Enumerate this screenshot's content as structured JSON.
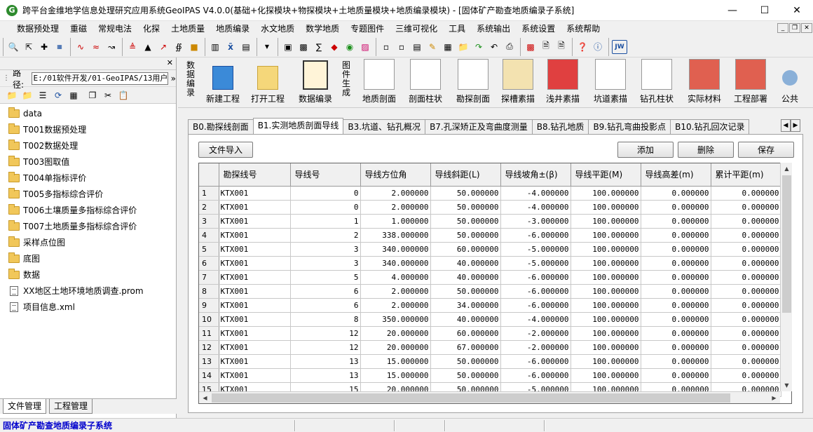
{
  "window": {
    "title": "跨平台金维地学信息处理研究应用系统GeoIPAS V4.0.0(基础+化探模块+物探模块+土地质量模块+地质编录模块) - [固体矿产勘查地质编录子系统]",
    "app_icon_letter": "G"
  },
  "menubar": [
    "数据预处理",
    "重磁",
    "常规电法",
    "化探",
    "土地质量",
    "地质编录",
    "水文地质",
    "数学地质",
    "专题图件",
    "三维可视化",
    "工具",
    "系统输出",
    "系统设置",
    "系统帮助"
  ],
  "left_panel": {
    "path_label": "路径:",
    "path_value": "E:/01软件开发/01-GeoIPAS/13用户",
    "tree": [
      {
        "type": "folder",
        "label": "data"
      },
      {
        "type": "folder",
        "label": "T001数据预处理"
      },
      {
        "type": "folder",
        "label": "T002数据处理"
      },
      {
        "type": "folder",
        "label": "T003图取值"
      },
      {
        "type": "folder",
        "label": "T004单指标评价"
      },
      {
        "type": "folder",
        "label": "T005多指标综合评价"
      },
      {
        "type": "folder",
        "label": "T006土壤质量多指标综合评价"
      },
      {
        "type": "folder",
        "label": "T007土地质量多指标综合评价"
      },
      {
        "type": "folder",
        "label": "采样点位图"
      },
      {
        "type": "folder",
        "label": "底图"
      },
      {
        "type": "folder",
        "label": "数据"
      },
      {
        "type": "file",
        "label": "XX地区土地环境地质调查.prom"
      },
      {
        "type": "file",
        "label": "项目信息.xml"
      }
    ],
    "tabs": [
      "文件管理",
      "工程管理"
    ]
  },
  "ribbon": {
    "group1_label": "数据编录",
    "group2_label": "图件生成",
    "buttons1": [
      "新建工程",
      "打开工程",
      "数据编录"
    ],
    "buttons2": [
      "地质剖面",
      "剖面柱状",
      "勘探剖面",
      "探槽素描",
      "浅井素描",
      "坑道素描",
      "钻孔柱状",
      "实际材料",
      "工程部署"
    ],
    "public_label": "公共"
  },
  "tabs": [
    "B0.勘探线剖面",
    "B1.实测地质剖面导线",
    "B3.坑道、钻孔概况",
    "B7.孔深矫正及弯曲度测量",
    "B8.钻孔地质",
    "B9.钻孔弯曲投影点",
    "B10.钻孔回次记录"
  ],
  "buttons": {
    "import": "文件导入",
    "add": "添加",
    "delete": "删除",
    "save": "保存"
  },
  "grid": {
    "columns": [
      "勘探线号",
      "导线号",
      "导线方位角",
      "导线斜距(L)",
      "导线坡角±(β)",
      "导线平距(M)",
      "导线高差(m)",
      "累计平距(m)"
    ],
    "rows": [
      [
        "1",
        "KTX001",
        "0",
        "2.000000",
        "50.000000",
        "-4.000000",
        "100.000000",
        "0.000000",
        "0.000000"
      ],
      [
        "2",
        "KTX001",
        "0",
        "2.000000",
        "50.000000",
        "-4.000000",
        "100.000000",
        "0.000000",
        "0.000000"
      ],
      [
        "3",
        "KTX001",
        "1",
        "1.000000",
        "50.000000",
        "-3.000000",
        "100.000000",
        "0.000000",
        "0.000000"
      ],
      [
        "4",
        "KTX001",
        "2",
        "338.000000",
        "50.000000",
        "-6.000000",
        "100.000000",
        "0.000000",
        "0.000000"
      ],
      [
        "5",
        "KTX001",
        "3",
        "340.000000",
        "60.000000",
        "-5.000000",
        "100.000000",
        "0.000000",
        "0.000000"
      ],
      [
        "6",
        "KTX001",
        "3",
        "340.000000",
        "40.000000",
        "-5.000000",
        "100.000000",
        "0.000000",
        "0.000000"
      ],
      [
        "7",
        "KTX001",
        "5",
        "4.000000",
        "40.000000",
        "-6.000000",
        "100.000000",
        "0.000000",
        "0.000000"
      ],
      [
        "8",
        "KTX001",
        "6",
        "2.000000",
        "50.000000",
        "-6.000000",
        "100.000000",
        "0.000000",
        "0.000000"
      ],
      [
        "9",
        "KTX001",
        "6",
        "2.000000",
        "34.000000",
        "-6.000000",
        "100.000000",
        "0.000000",
        "0.000000"
      ],
      [
        "10",
        "KTX001",
        "8",
        "350.000000",
        "40.000000",
        "-4.000000",
        "100.000000",
        "0.000000",
        "0.000000"
      ],
      [
        "11",
        "KTX001",
        "12",
        "20.000000",
        "60.000000",
        "-2.000000",
        "100.000000",
        "0.000000",
        "0.000000"
      ],
      [
        "12",
        "KTX001",
        "12",
        "20.000000",
        "67.000000",
        "-2.000000",
        "100.000000",
        "0.000000",
        "0.000000"
      ],
      [
        "13",
        "KTX001",
        "13",
        "15.000000",
        "50.000000",
        "-6.000000",
        "100.000000",
        "0.000000",
        "0.000000"
      ],
      [
        "14",
        "KTX001",
        "13",
        "15.000000",
        "50.000000",
        "-6.000000",
        "100.000000",
        "0.000000",
        "0.000000"
      ],
      [
        "15",
        "KTX001",
        "15",
        "20.000000",
        "50.000000",
        "-5.000000",
        "100.000000",
        "0.000000",
        "0.000000"
      ]
    ]
  },
  "status": {
    "text": "固体矿产勘查地质编录子系统"
  }
}
